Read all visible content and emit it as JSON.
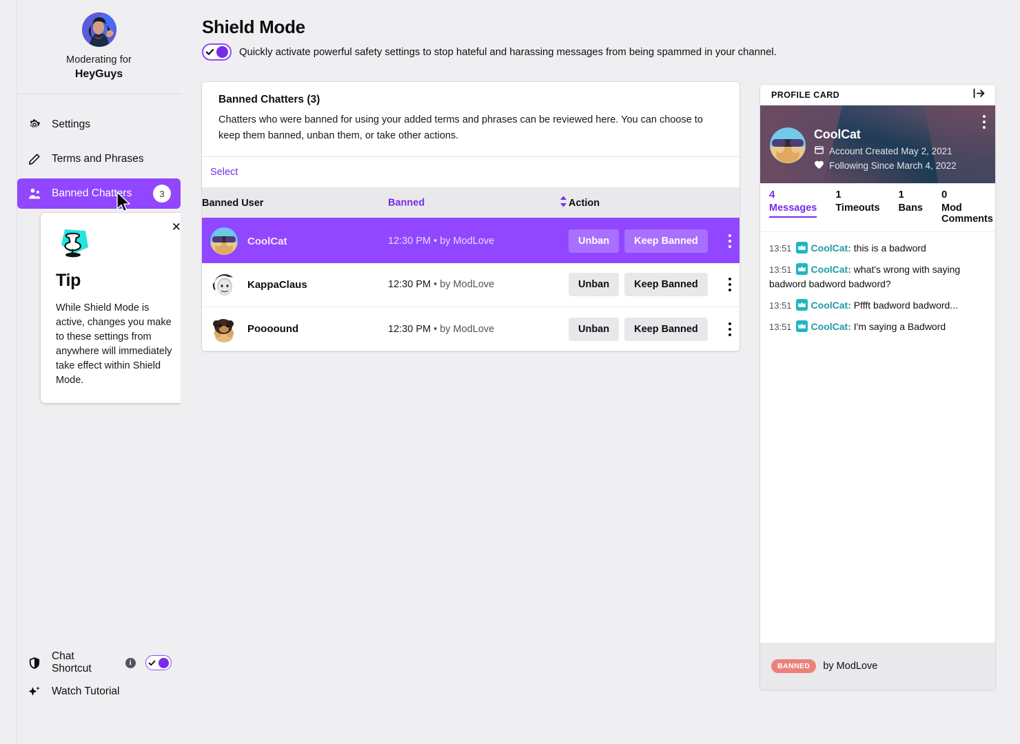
{
  "sidebar": {
    "moderating_label": "Moderating for",
    "channel": "HeyGuys",
    "items": [
      {
        "label": "Settings",
        "icon": "gear-icon",
        "badge": null
      },
      {
        "label": "Terms and Phrases",
        "icon": "pencil-icon",
        "badge": null
      },
      {
        "label": "Banned Chatters",
        "icon": "users-icon",
        "badge": "3"
      }
    ],
    "footer": {
      "chat_shortcut": "Chat Shortcut",
      "chat_shortcut_info_icon": "info-icon",
      "watch_tutorial": "Watch Tutorial",
      "watch_tutorial_icon": "sparkle-icon",
      "shield_icon": "shield-icon"
    }
  },
  "tip": {
    "close_icon": "close-icon",
    "icon": "pushpin-icon",
    "title": "Tip",
    "body": "While Shield Mode is active, changes you make to these settings from anywhere will immediately take effect within Shield Mode."
  },
  "main": {
    "title": "Shield Mode",
    "shield_toggle_state": "on",
    "shield_description": "Quickly activate powerful safety settings to stop hateful and harassing messages from being spammed in your channel.",
    "banned_card": {
      "title": "Banned Chatters (3)",
      "subtitle": "Chatters who were banned for using your added terms and phrases can be reviewed here. You can choose to keep them banned, unban them, or take other actions.",
      "select_label": "Select",
      "columns": [
        "Banned User",
        "Banned",
        "Action"
      ],
      "sort_icon": "sort-updown-icon",
      "rows": [
        {
          "user": "CoolCat",
          "time": "12:30 PM",
          "separator": "•",
          "by": "by ModLove",
          "unban": "Unban",
          "keep": "Keep Banned",
          "menu_icon": "kebab-menu-icon",
          "selected": true
        },
        {
          "user": "KappaClaus",
          "time": "12:30 PM",
          "separator": "•",
          "by": "by ModLove",
          "unban": "Unban",
          "keep": "Keep Banned",
          "menu_icon": "kebab-menu-icon",
          "selected": false
        },
        {
          "user": "Poooound",
          "time": "12:30 PM",
          "separator": "•",
          "by": "by ModLove",
          "unban": "Unban",
          "keep": "Keep Banned",
          "menu_icon": "kebab-menu-icon",
          "selected": false
        }
      ]
    }
  },
  "profile_card": {
    "header_title": "PROFILE CARD",
    "collapse_icon": "collapse-panel-icon",
    "kebab_icon": "kebab-menu-icon",
    "name": "CoolCat",
    "account_created": "Account Created May 2, 2021",
    "account_created_icon": "calendar-icon",
    "following_since": "Following Since March 4, 2022",
    "following_since_icon": "heart-icon",
    "tabs": [
      {
        "num": "4",
        "label": "Messages",
        "active": true
      },
      {
        "num": "1",
        "label": "Timeouts",
        "active": false
      },
      {
        "num": "1",
        "label": "Bans",
        "active": false
      },
      {
        "num": "0",
        "label": "Mod Comments",
        "active": false
      }
    ],
    "messages": [
      {
        "time": "13:51",
        "badge_icon": "broadcaster-badge-icon",
        "author": "CoolCat:",
        "text": "this is a badword"
      },
      {
        "time": "13:51",
        "badge_icon": "broadcaster-badge-icon",
        "author": "CoolCat:",
        "text": "what's wrong with saying badword badword badword?"
      },
      {
        "time": "13:51",
        "badge_icon": "broadcaster-badge-icon",
        "author": "CoolCat:",
        "text": "Pffft badword badword..."
      },
      {
        "time": "13:51",
        "badge_icon": "broadcaster-badge-icon",
        "author": "CoolCat:",
        "text": "I'm saying a Badword"
      }
    ],
    "footer": {
      "status": "BANNED",
      "by": "by ModLove"
    }
  },
  "colors": {
    "accent_purple": "#9146ff",
    "link_purple": "#772ce8",
    "page_bg": "#efeff1",
    "card_bg": "#ffffff",
    "banned_red": "#ec8179",
    "badge_teal": "#1fb6c1"
  }
}
